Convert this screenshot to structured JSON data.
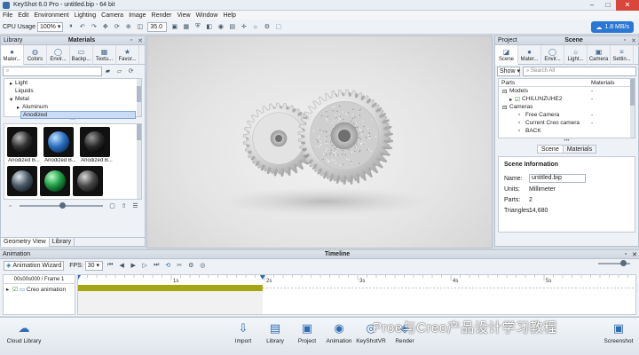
{
  "window": {
    "title": "KeyShot 6.0 Pro - untitled.bip - 64 bit"
  },
  "menu": [
    "File",
    "Edit",
    "Environment",
    "Lighting",
    "Camera",
    "Image",
    "Render",
    "View",
    "Window",
    "Help"
  ],
  "toolbar": {
    "cpu_label": "CPU Usage",
    "cpu_value": "100%",
    "fov_value": "35.0",
    "net_speed": "1.8 MB/s"
  },
  "library": {
    "panel_label": "Library",
    "title": "Materials",
    "tabs": [
      {
        "label": "Mater...",
        "icon": "sphere-icon"
      },
      {
        "label": "Colors",
        "icon": "palette-icon"
      },
      {
        "label": "Envir...",
        "icon": "globe-icon"
      },
      {
        "label": "Backp...",
        "icon": "image-icon"
      },
      {
        "label": "Textu...",
        "icon": "grid-icon"
      },
      {
        "label": "Favor...",
        "icon": "star-icon"
      }
    ],
    "tree": [
      {
        "label": "Light",
        "indent": 1,
        "arrow": "▸"
      },
      {
        "label": "Liquids",
        "indent": 1,
        "arrow": ""
      },
      {
        "label": "Metal",
        "indent": 1,
        "arrow": "▾"
      },
      {
        "label": "Aluminum",
        "indent": 2,
        "arrow": "▸"
      },
      {
        "label": "Anodized",
        "indent": 2,
        "arrow": ""
      }
    ],
    "thumbnails": [
      {
        "label": "Anodized B...",
        "color": "#1c1c1c"
      },
      {
        "label": "Anodized B...",
        "color": "#1f5fa8"
      },
      {
        "label": "Anodized B...",
        "color": "#202020"
      },
      {
        "label": "",
        "color": "#2f3a44"
      },
      {
        "label": "",
        "color": "#1e8a3a"
      },
      {
        "label": "",
        "color": "#2b2f33"
      }
    ],
    "bottom_tabs": [
      "Geometry View",
      "Library"
    ]
  },
  "project": {
    "panel_label": "Project",
    "title": "Scene",
    "tabs": [
      {
        "label": "Scene",
        "icon": "scene-icon"
      },
      {
        "label": "Mater...",
        "icon": "sphere-icon"
      },
      {
        "label": "Envir...",
        "icon": "globe-icon"
      },
      {
        "label": "Light...",
        "icon": "bulb-icon"
      },
      {
        "label": "Camera",
        "icon": "camera-icon"
      },
      {
        "label": "Settin...",
        "icon": "sliders-icon"
      }
    ],
    "show_label": "Show",
    "search_placeholder": "Search All",
    "cols": [
      "Parts",
      "Materials"
    ],
    "tree": [
      {
        "label": "Models",
        "indent": 1,
        "value": "-"
      },
      {
        "label": "CHILUNZUHE2",
        "indent": 2,
        "value": "-"
      },
      {
        "label": "Cameras",
        "indent": 1,
        "value": ""
      },
      {
        "label": "Free Camera",
        "indent": 3,
        "value": "-"
      },
      {
        "label": "Current Creo camera",
        "indent": 3,
        "value": "-"
      },
      {
        "label": "BACK",
        "indent": 3,
        "value": ""
      }
    ],
    "subtabs": [
      "Scene",
      "Materials"
    ],
    "info_title": "Scene Information",
    "info": [
      {
        "k": "Name:",
        "v": "untitled.bip"
      },
      {
        "k": "Units:",
        "v": "Millimeter"
      },
      {
        "k": "Parts:",
        "v": "2"
      },
      {
        "k": "Triangles:",
        "v": "14,680"
      }
    ]
  },
  "timeline": {
    "panel_label": "Animation",
    "title": "Timeline",
    "wizard_label": "Animation Wizard",
    "fps_label": "FPS:",
    "fps_value": "30",
    "frame_label": "00s00s000 / Frame 1",
    "track_label": "Creo animation",
    "ticks": [
      "0",
      "1s",
      "2s",
      "3s",
      "4s",
      "5s"
    ],
    "clip_fraction": 0.33
  },
  "bottom": {
    "left_label": "Cloud Library",
    "items": [
      {
        "label": "Import",
        "icon": "import-icon",
        "glyph": "⇩"
      },
      {
        "label": "Library",
        "icon": "book-icon",
        "glyph": "▤"
      },
      {
        "label": "Project",
        "icon": "clipboard-icon",
        "glyph": "▣"
      },
      {
        "label": "Animation",
        "icon": "film-icon",
        "glyph": "◉"
      },
      {
        "label": "KeyShotVR",
        "icon": "vr-icon",
        "glyph": "◎"
      },
      {
        "label": "Render",
        "icon": "render-icon",
        "glyph": "◈"
      }
    ],
    "right_label": "Screenshot",
    "watermark": "Proe与Creo产品设计学习教程"
  }
}
